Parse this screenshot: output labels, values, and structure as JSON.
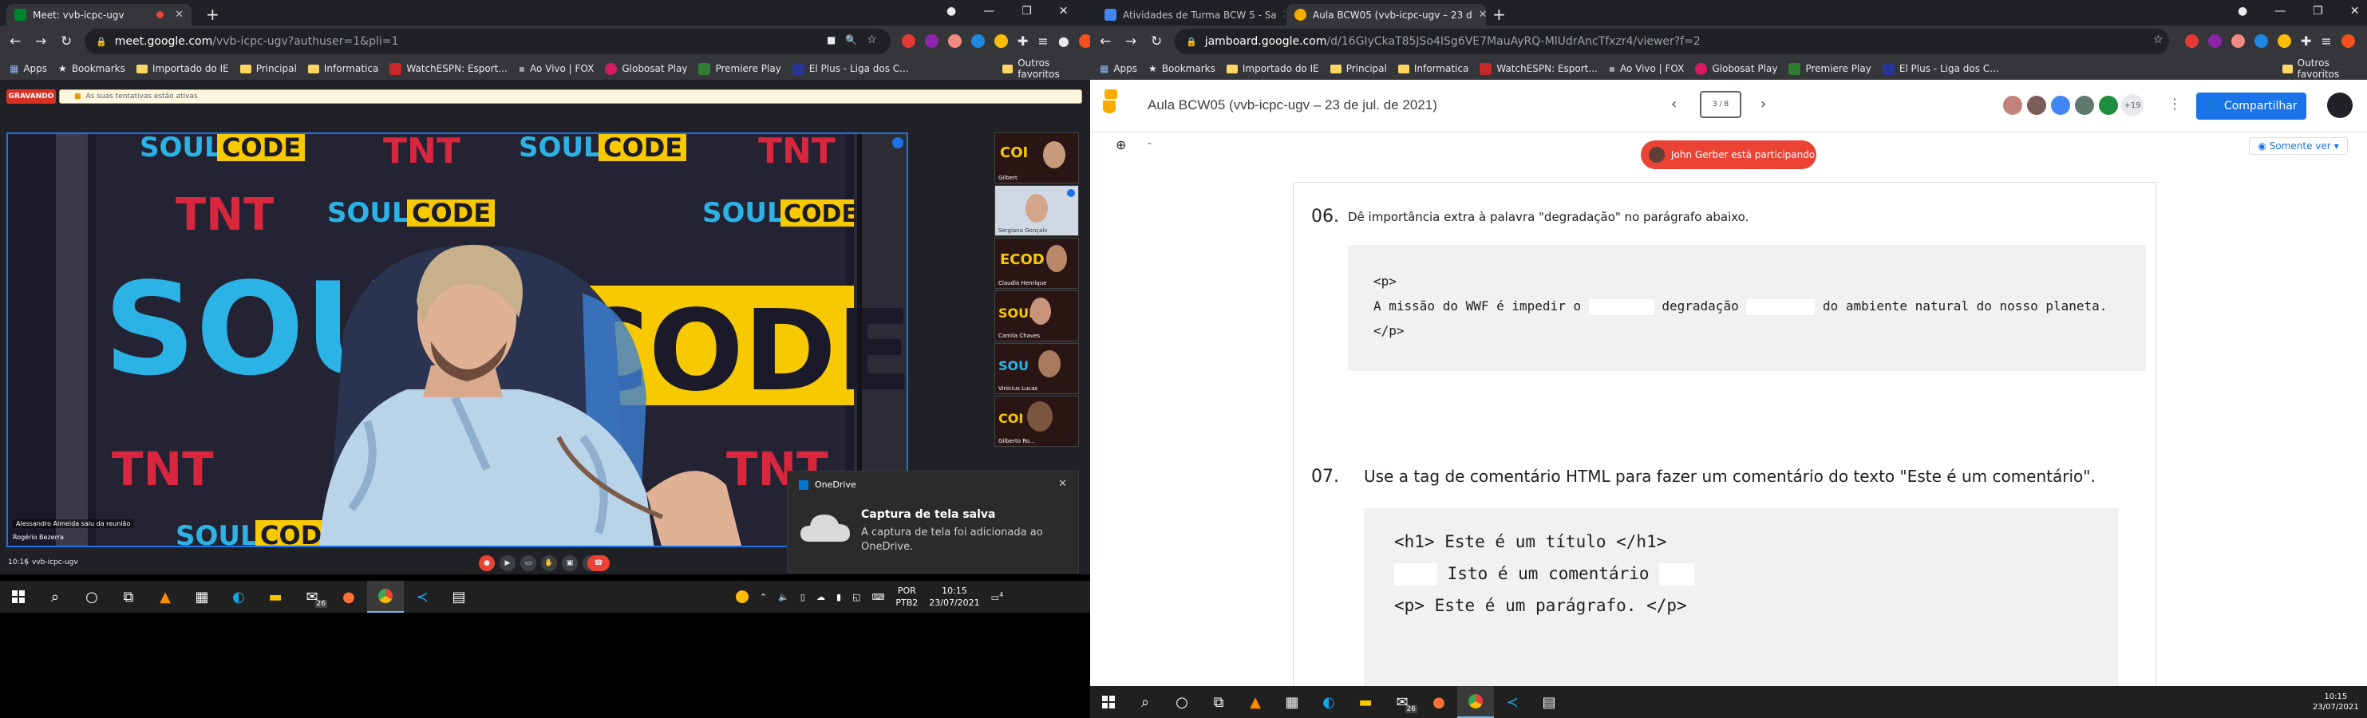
{
  "left": {
    "tab": {
      "title": "Meet: vvb-icpc-ugv"
    },
    "url": {
      "domain": "meet.google.com",
      "path": "/vvb-icpc-ugv?authuser=1&pli=1"
    },
    "bookmarks": [
      "Apps",
      "Bookmarks",
      "Importado do IE",
      "Principal",
      "Informatica",
      "WatchESPN: Esport...",
      "Ao Vivo | FOX",
      "Globosat Play",
      "Premiere Play",
      "El Plus - Liga dos C..."
    ],
    "bookmarks_other": "Outros favoritos",
    "meet": {
      "recording_badge": "GRAVANDO",
      "banner_text": "As suas tentativas estão ativas",
      "speaker_name": "Alessandro Almeida saiu da reunião",
      "presenter_name": "Rogério Bezerra",
      "thumbnails": [
        "Gilbert",
        "Sergiana Gonçalv",
        "Claudio Henrique",
        "Camila Chaves",
        "Vinicius Lucas",
        "Gilberto Ro..."
      ],
      "time": "10:16",
      "meeting_code": "vvb-icpc-ugv",
      "video_text": {
        "brand1": "SOUL",
        "brand2": "CODE",
        "tnt": "TNT"
      }
    },
    "toast": {
      "app": "OneDrive",
      "title": "Captura de tela salva",
      "body": "A captura de tela foi adicionada ao OneDrive."
    },
    "taskbar": {
      "lang_top": "POR",
      "lang_bottom": "PTB2",
      "time": "10:15",
      "date": "23/07/2021",
      "mail_badge": "26",
      "notif_badge": "4"
    }
  },
  "right": {
    "tabs": [
      {
        "title": "Atividades de Turma BCW 5 - Sa"
      },
      {
        "title": "Aula BCW05 (vvb-icpc-ugv – 23 d"
      }
    ],
    "url": {
      "domain": "jamboard.google.com",
      "path": "/d/16GIyCkaT85JSo4ISg6VE7MauAyRQ-MlUdrAncTfxzr4/viewer?f=2"
    },
    "bookmarks": [
      "Apps",
      "Bookmarks",
      "Importado do IE",
      "Principal",
      "Informatica",
      "WatchESPN: Esport...",
      "Ao Vivo | FOX",
      "Globosat Play",
      "Premiere Play",
      "El Plus - Liga dos C..."
    ],
    "bookmarks_other": "Outros favoritos",
    "jam": {
      "title": "Aula BCW05 (vvb-icpc-ugv – 23 de jul. de 2021)",
      "frame_counter": "3 / 8",
      "avatar_more": "+19",
      "share_label": "Compartilhar",
      "view_only_label": "Somente ver",
      "participant_toast": "John Gerber está participando",
      "q6": {
        "number": "06.",
        "text": "Dê importância extra à palavra \"degradação\" no parágrafo abaixo.",
        "code_open": "<p>",
        "code_a": "A missão do WWF é impedir o",
        "code_word": "degradação",
        "code_b": "do ambiente natural do nosso planeta.",
        "code_close": "</p>"
      },
      "q7": {
        "number": "07.",
        "text": "Use a tag de comentário HTML para fazer um comentário do texto \"Este é um comentário\".",
        "line1": "<h1> Este é um título </h1>",
        "line2": "Isto é um comentário",
        "line3": "<p> Este é um parágrafo. </p>"
      }
    },
    "taskbar": {
      "time": "10:15",
      "date": "23/07/2021",
      "mail_badge": "26"
    }
  },
  "colors": {
    "chrome_dark": "#202124",
    "chrome_toolbar": "#35363a",
    "meet_accent": "#1a73e8",
    "jam_share": "#1a73e8",
    "toast_red": "#ea4335",
    "soul_yellow": "#f7c900",
    "soul_blue": "#2bb3e6"
  }
}
